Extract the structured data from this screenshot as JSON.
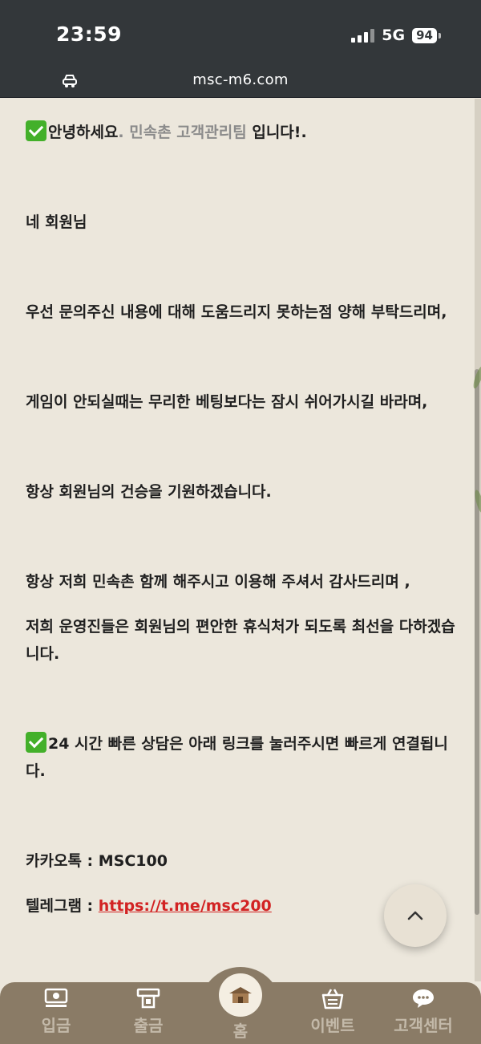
{
  "status_bar": {
    "time": "23:59",
    "network": "5G",
    "battery": "94"
  },
  "browser": {
    "url": "msc-m6.com",
    "site_icon": "car-icon"
  },
  "message": {
    "greeting_prefix": "안녕하세요",
    "greeting_dot": ". ",
    "greeting_team": "민속촌 고객관리팀",
    "greeting_suffix": " 입니다!.",
    "line_member": "네 회원님",
    "line_apology": "우선 문의주신 내용에 대해 도움드리지 못하는점 양해 부탁드리며,",
    "line_rest": "게임이 안되실때는 무리한 베팅보다는 잠시 쉬어가시길 바라며,",
    "line_wish": "항상 회원님의 건승을 기원하겠습니다.",
    "line_thanks": "항상 저희 민속촌 함께 해주시고 이용해 주셔서 감사드리며 ,",
    "line_staff": "저희 운영진들은 회원님의 편안한 휴식처가 되도록 최선을 다하겠습니다.",
    "line_contact": "24 시간 빠른 상담은 아래 링크를 눌러주시면 빠르게 연결됩니다.",
    "kakao_label": "카카오톡 : ",
    "kakao_id": "MSC100",
    "telegram_label": "텔레그램 : ",
    "telegram_link": "https://t.me/msc200"
  },
  "bottom_nav": {
    "items": [
      {
        "label": "입금",
        "icon": "deposit-icon"
      },
      {
        "label": "출금",
        "icon": "withdraw-icon"
      },
      {
        "label": "홈",
        "icon": "home-icon"
      },
      {
        "label": "이벤트",
        "icon": "gift-icon"
      },
      {
        "label": "고객센터",
        "icon": "chat-support-icon"
      }
    ]
  },
  "colors": {
    "status_bg": "#33373a",
    "page_bg": "#ece7dc",
    "nav_bg": "#8a7b66",
    "check_green": "#43b02a",
    "link_red": "#d22323"
  }
}
